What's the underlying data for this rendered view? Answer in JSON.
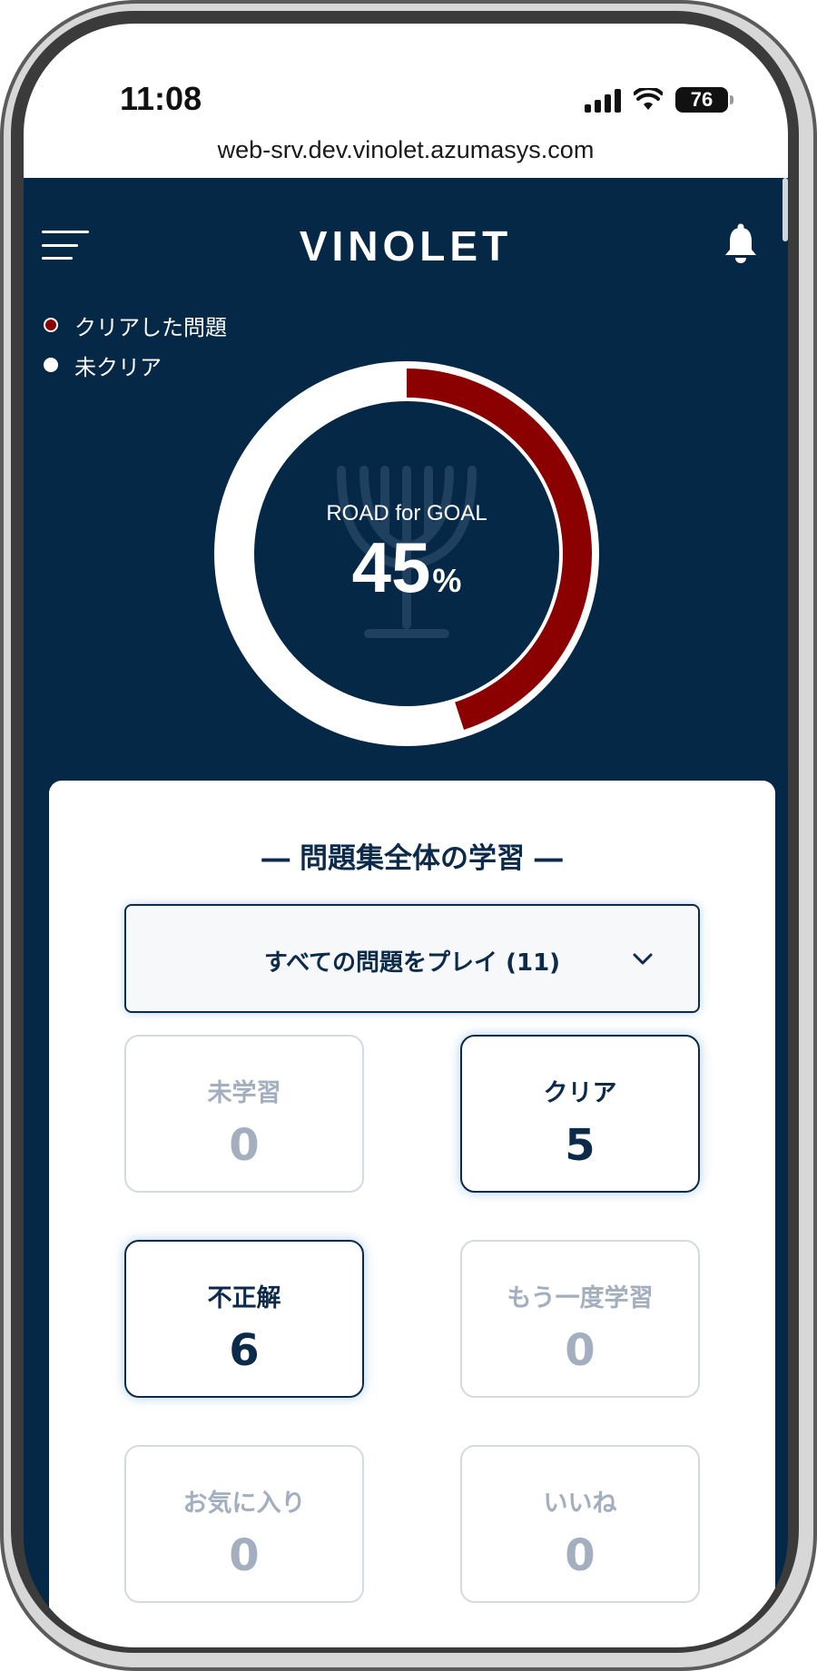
{
  "status_bar": {
    "time": "11:08",
    "battery": "76",
    "icons": [
      "signal-icon",
      "wifi-icon",
      "battery-icon"
    ]
  },
  "browser": {
    "url": "web-srv.dev.vinolet.azumasys.com"
  },
  "header": {
    "brand": "VINOLET",
    "icons": [
      "menu-icon",
      "bell-icon"
    ]
  },
  "legend": {
    "cleared": "クリアした問題",
    "uncleared": "未クリア"
  },
  "progress": {
    "label": "ROAD for GOAL",
    "value": "45",
    "unit": "%",
    "fraction": 0.45
  },
  "study": {
    "title": "― 問題集全体の学習 ―",
    "dropdown_label": "すべての問題をプレイ (11)",
    "stats": [
      {
        "label": "未学習",
        "value": "0",
        "active": false
      },
      {
        "label": "クリア",
        "value": "5",
        "active": true
      },
      {
        "label": "不正解",
        "value": "6",
        "active": true
      },
      {
        "label": "もう一度学習",
        "value": "0",
        "active": false
      },
      {
        "label": "お気に入り",
        "value": "0",
        "active": false
      },
      {
        "label": "いいね",
        "value": "0",
        "active": false
      }
    ]
  },
  "colors": {
    "navy": "#062847",
    "accent_red": "#8b0000",
    "text_navy": "#0c2a4a",
    "muted": "#a3afbe"
  }
}
